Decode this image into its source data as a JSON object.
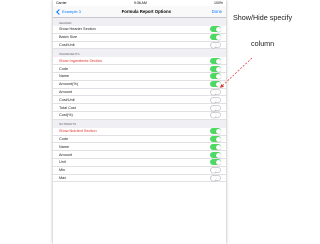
{
  "status_bar": {
    "left": "Carrier",
    "time": "9:36 AM",
    "right": "100%"
  },
  "nav": {
    "back": "Example 3",
    "title": "Formula Report Options",
    "done": "Done"
  },
  "sections": [
    {
      "header": "HEADER",
      "rows": [
        {
          "label": "Show Header Section",
          "on": true,
          "red": false
        },
        {
          "label": "Batch Size",
          "on": true,
          "red": false
        },
        {
          "label": "Cost/Unit",
          "on": false,
          "red": false
        }
      ]
    },
    {
      "header": "INGREDIENTS",
      "rows": [
        {
          "label": "Show Ingredients Section",
          "on": true,
          "red": true
        },
        {
          "label": "Code",
          "on": true,
          "red": false
        },
        {
          "label": "Name",
          "on": true,
          "red": false
        },
        {
          "label": "Amount(%)",
          "on": true,
          "red": false
        },
        {
          "label": "Amount",
          "on": false,
          "red": false
        },
        {
          "label": "Cost/Unit",
          "on": false,
          "red": false
        },
        {
          "label": "Total Cost",
          "on": false,
          "red": false
        },
        {
          "label": "Cost(%)",
          "on": false,
          "red": false
        }
      ]
    },
    {
      "header": "NUTRIENTS",
      "rows": [
        {
          "label": "Show Nutrient Section",
          "on": true,
          "red": true
        },
        {
          "label": "Code",
          "on": true,
          "red": false
        },
        {
          "label": "Name",
          "on": true,
          "red": false
        },
        {
          "label": "Amount",
          "on": true,
          "red": false
        },
        {
          "label": "Unit",
          "on": true,
          "red": false
        },
        {
          "label": "Min",
          "on": false,
          "red": false
        },
        {
          "label": "Max",
          "on": false,
          "red": false
        }
      ]
    }
  ],
  "annotation": {
    "line1": "Show/Hide specify",
    "line2": "column"
  },
  "colors": {
    "accent": "#007aff",
    "toggle_on": "#4cd964",
    "red_label": "#e0342b",
    "arrow": "#e03030"
  }
}
